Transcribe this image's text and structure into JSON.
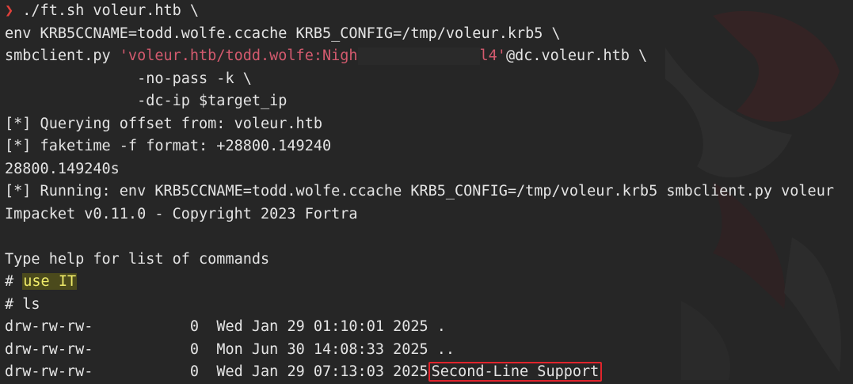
{
  "terminal": {
    "line1": {
      "prompt_symbol": "❯",
      "command": " ./ft.sh voleur.htb \\"
    },
    "line2": "env KRB5CCNAME=todd.wolfe.ccache KRB5_CONFIG=/tmp/voleur.krb5 \\",
    "line3": {
      "prefix": "smbclient.py ",
      "arg_start": "'voleur.htb/todd.wolfe:Nigh",
      "arg_end": "l4'",
      "suffix": "@dc.voleur.htb \\"
    },
    "line4": "               -no-pass -k \\",
    "line5": "               -dc-ip $target_ip",
    "line6": "[*] Querying offset from: voleur.htb",
    "line7": "[*] faketime -f format: +28800.149240",
    "line8": "28800.149240s",
    "line9": "[*] Running: env KRB5CCNAME=todd.wolfe.ccache KRB5_CONFIG=/tmp/voleur.krb5 smbclient.py voleur",
    "line10": "Impacket v0.11.0 - Copyright 2023 Fortra",
    "line12": "Type help for list of commands",
    "line13": {
      "prompt": "# ",
      "command": "use IT"
    },
    "line14": "# ls",
    "listing": [
      {
        "perms": "drw-rw-rw-",
        "size": "0",
        "date": "Wed Jan 29 01:10:01 2025",
        "name": "."
      },
      {
        "perms": "drw-rw-rw-",
        "size": "0",
        "date": "Mon Jun 30 14:08:33 2025",
        "name": ".."
      },
      {
        "perms": "drw-rw-rw-",
        "size": "0",
        "date": "Wed Jan 29 07:13:03 2025",
        "name": "Second-Line Support"
      }
    ]
  },
  "colors": {
    "background": "#262626",
    "text": "#e4e4e4",
    "prompt": "#e0403a",
    "quoted_string": "#d35a6e",
    "highlight_bg": "#4b4a1c",
    "highlight_text": "#f0ec6a",
    "annotation_box": "#e0242c"
  }
}
